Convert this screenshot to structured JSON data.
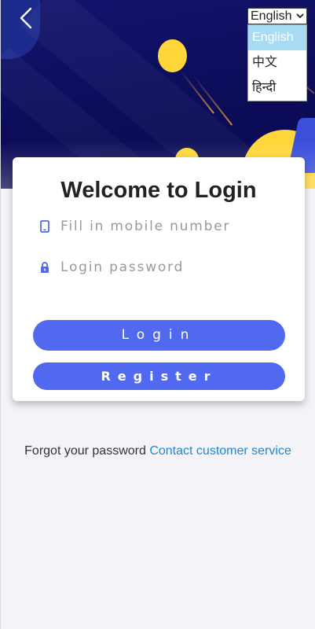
{
  "language": {
    "selected": "English",
    "options": [
      "English",
      "中文",
      "हिन्दी"
    ]
  },
  "login": {
    "title": "Welcome to Login",
    "phone_placeholder": "Fill in mobile number",
    "password_placeholder": "Login password",
    "login_button": "Login",
    "register_button": "Register"
  },
  "footer": {
    "forgot_text": "Forgot your password",
    "contact_link": "Contact customer service"
  },
  "colors": {
    "accent": "#5169ee",
    "link": "#1e88d6",
    "hero_bg": "#0c0c5a",
    "planet": "#ffd63a"
  }
}
